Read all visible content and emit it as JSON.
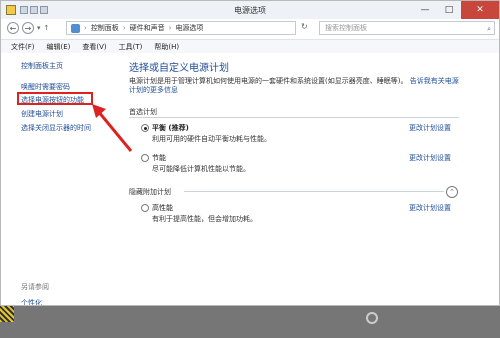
{
  "window": {
    "title": "电源选项",
    "buttons": {
      "minimize": "—",
      "maximize": "□",
      "close": "✕"
    }
  },
  "address": {
    "path": [
      "控制面板",
      "硬件和声音",
      "电源选项"
    ],
    "search_placeholder": "搜索控制面板"
  },
  "menu": [
    "文件(F)",
    "编辑(E)",
    "查看(V)",
    "工具(T)",
    "帮助(H)"
  ],
  "sidebar": {
    "items": [
      {
        "label": "控制面板主页"
      },
      {
        "label": "唤醒时需要密码"
      },
      {
        "label": "选择电源按钮的功能"
      },
      {
        "label": "创建电源计划"
      },
      {
        "label": "选择关闭显示器的时间"
      }
    ],
    "see_also": "另请参阅",
    "see_also_item": "个性化"
  },
  "main": {
    "heading": "选择或自定义电源计划",
    "description": "电源计划是用于管理计算机如何使用电源的一套硬件和系统设置(如显示器亮度、睡眠等)。",
    "description_link": "告诉我有关电源计划的更多信息",
    "preferred_section": "首选计划",
    "plans": [
      {
        "name": "平衡 (推荐)",
        "desc": "利用可用的硬件自动平衡功耗与性能。",
        "selected": true,
        "change": "更改计划设置"
      },
      {
        "name": "节能",
        "desc": "尽可能降低计算机性能以节能。",
        "selected": false,
        "change": "更改计划设置"
      }
    ],
    "hidden_section": "隐藏附加计划",
    "hidden_plans": [
      {
        "name": "高性能",
        "desc": "有利于提高性能，但会增加功耗。",
        "selected": false,
        "change": "更改计划设置"
      }
    ]
  },
  "annotation": {
    "color": "#d22222"
  }
}
